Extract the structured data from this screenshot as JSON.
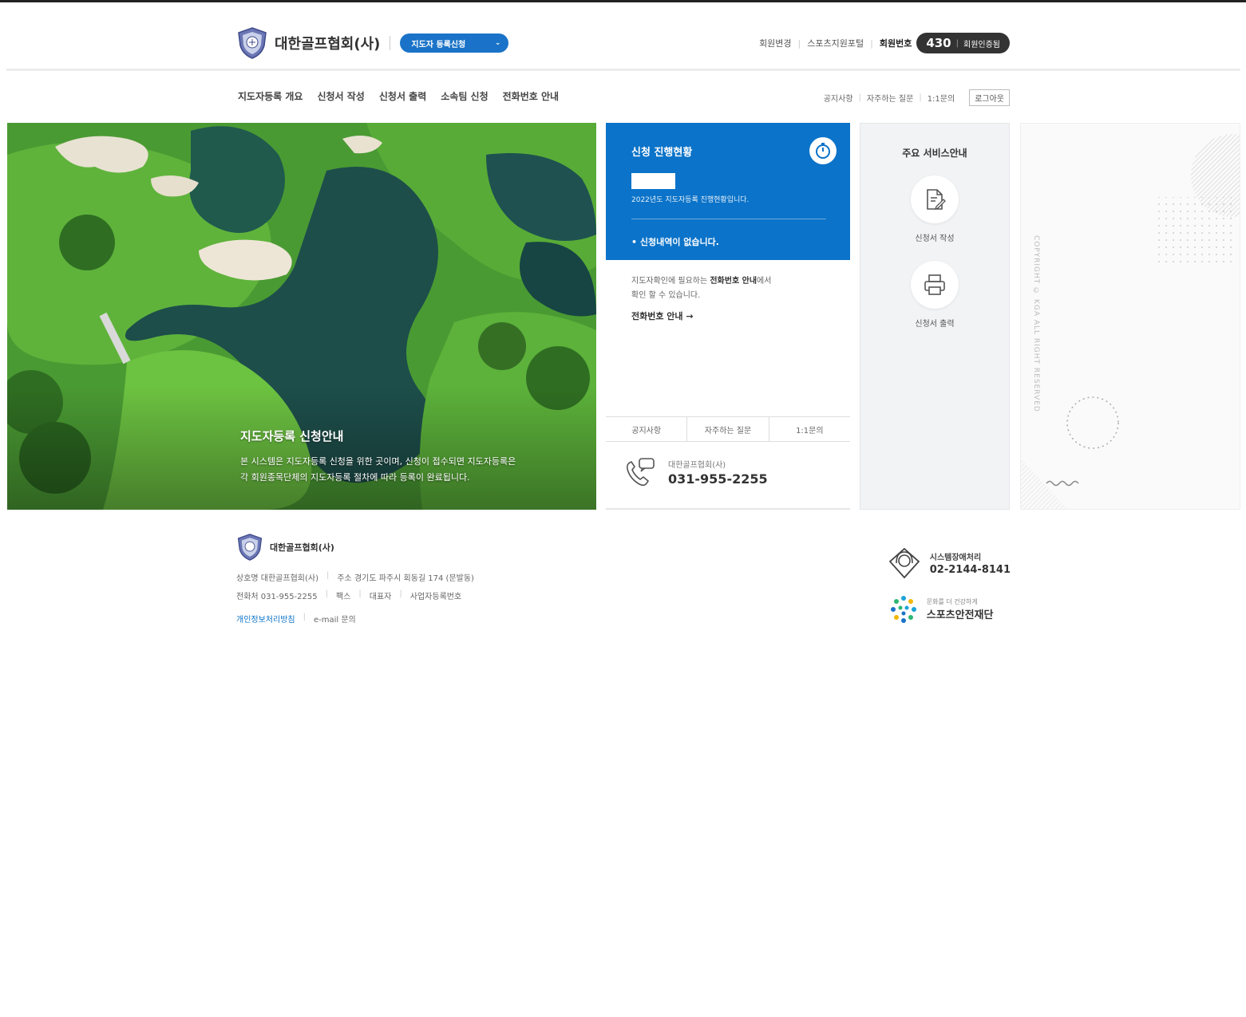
{
  "header": {
    "org_name": "대한골프협회(사)",
    "site_select": "지도자 등록신청",
    "util_links": [
      "회원변경",
      "스포츠지원포털"
    ],
    "reg_label": "회원번호",
    "reg_number": "430",
    "reg_status": "회원인증됨"
  },
  "gnb": {
    "items": [
      "지도자등록 개요",
      "신청서 작성",
      "신청서 출력",
      "소속팀 신청",
      "전화번호 안내"
    ]
  },
  "sub_util": {
    "items": [
      "공지사항",
      "자주하는 질문",
      "1:1문의"
    ],
    "login": "로그아웃"
  },
  "hero": {
    "title": "지도자등록 신청안내",
    "desc_line1": "본 시스템은 지도자등록 신청을 위한 곳이며, 신청이 접수되면 지도자등록은",
    "desc_line2": "각 회원종목단체의 지도자등록 절차에 따라 등록이 완료됩니다."
  },
  "status": {
    "title": "신청 진행현황",
    "year_note": "2022년도 지도자등록 진행현황입니다.",
    "empty_msg": "• 신청내역이 없습니다.",
    "info_line1_pre": "지도자확인에 필요하는 ",
    "info_line1_bold": "전화번호 안내",
    "info_line1_post": "에서",
    "info_line2": "확인 할 수 있습니다.",
    "link": "전화번호 안내 →",
    "tabs": [
      "공지사항",
      "자주하는 질문",
      "1:1문의"
    ],
    "phone_label": "대한골프협회(사)",
    "phone_number": "031-955-2255"
  },
  "services": {
    "title": "주요 서비스안내",
    "items": [
      {
        "label": "신청서 작성",
        "icon": "document-edit-icon"
      },
      {
        "label": "신청서 출력",
        "icon": "printer-icon"
      }
    ]
  },
  "decor": {
    "copyright": "COPYRIGHT © KGA ALL RIGHT RESERVED"
  },
  "footer": {
    "org_name": "대한골프협회(사)",
    "line1": [
      "상호명 대한골프협회(사)",
      "주소 경기도 파주시 회동길 174 (문발동)"
    ],
    "line2": [
      "전화처 031-955-2255",
      "팩스",
      "대표자",
      "사업자등록번호"
    ],
    "privacy": "개인정보처리방침",
    "email": "e-mail 문의"
  },
  "help": {
    "label": "시스템장애처리",
    "number": "02-2144-8141"
  },
  "sponsor": {
    "small": "문화를 더 건강하게",
    "name": "스포츠안전재단"
  },
  "colors": {
    "primary_blue": "#0b73c9",
    "select_blue": "#1a73c8",
    "dark_pill": "#333333",
    "panel_gray": "#f1f3f5"
  }
}
